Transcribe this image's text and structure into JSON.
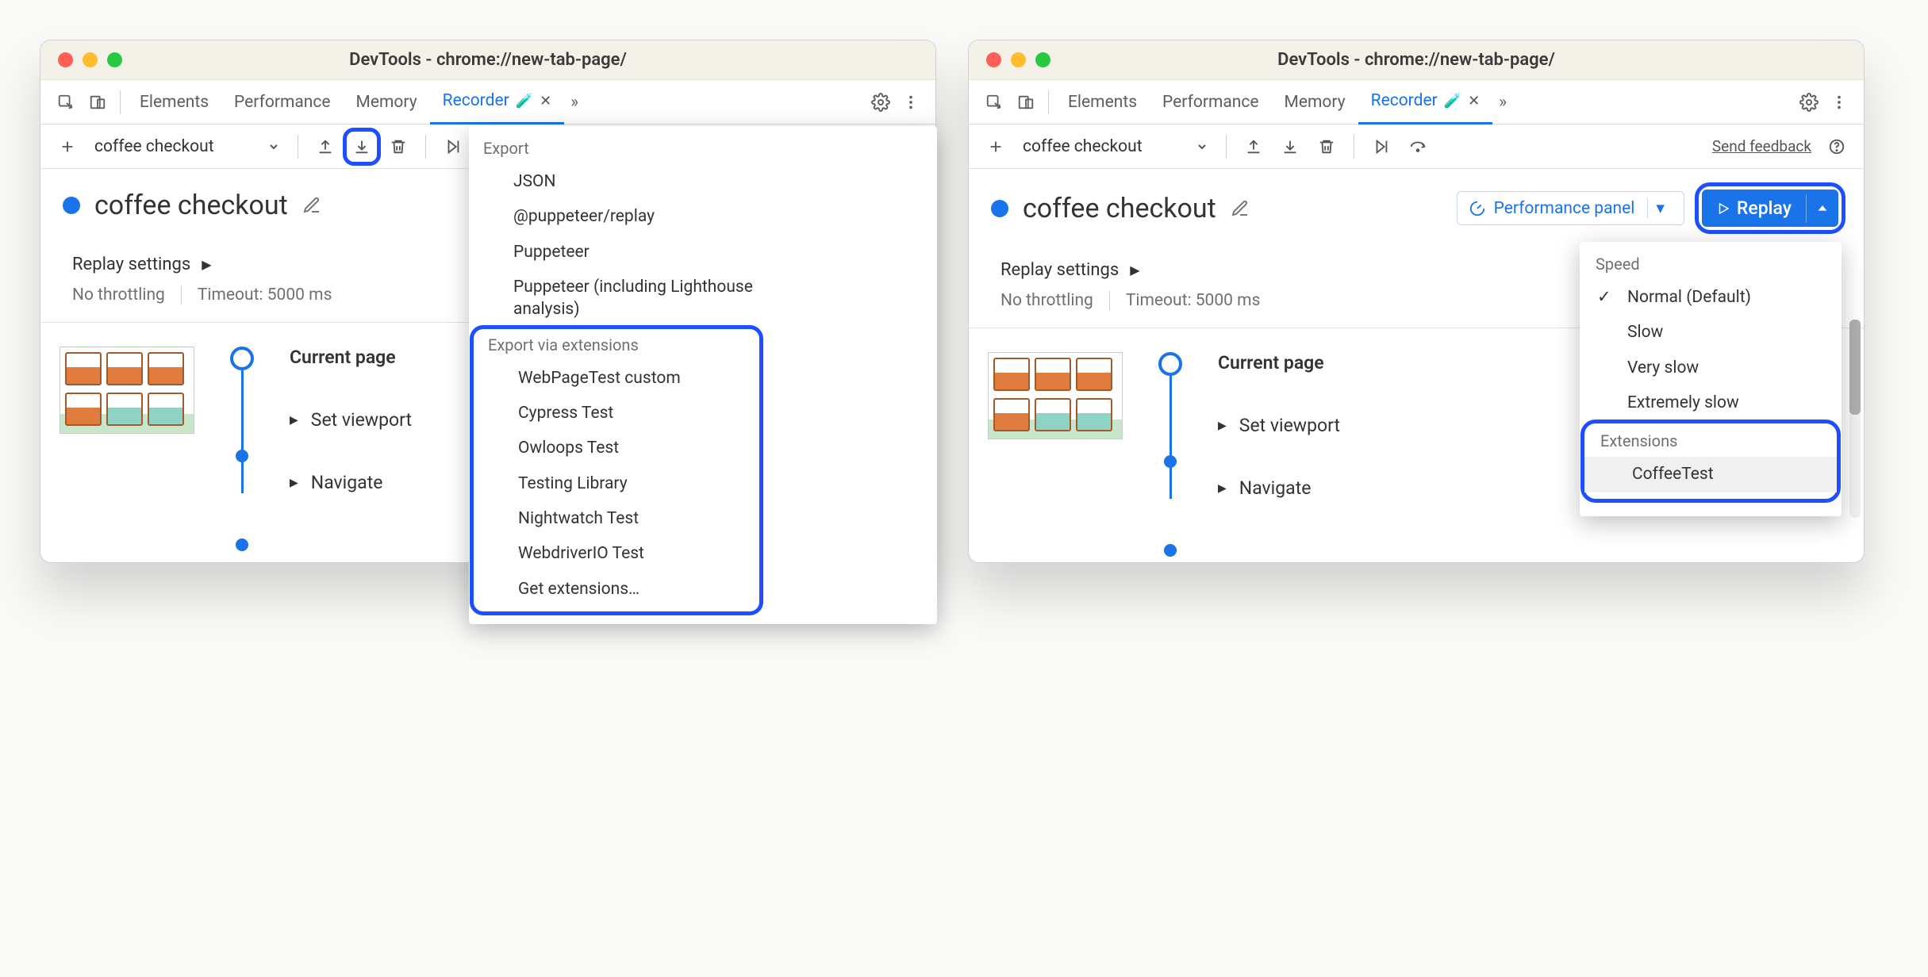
{
  "window_title": "DevTools - chrome://new-tab-page/",
  "tabs": {
    "elements": "Elements",
    "performance": "Performance",
    "memory": "Memory",
    "recorder": "Recorder",
    "recorder_experiment_icon": "🧪"
  },
  "more_tabs_icon": "»",
  "toolbar": {
    "recording_name": "coffee checkout",
    "send_feedback": "Send feedback"
  },
  "recording": {
    "title": "coffee checkout",
    "perf_panel_label": "Performance panel",
    "replay_label": "Replay"
  },
  "replay_settings": {
    "label": "Replay settings",
    "throttling": "No throttling",
    "timeout": "Timeout: 5000 ms"
  },
  "steps": {
    "current_page": "Current page",
    "set_viewport": "Set viewport",
    "navigate": "Navigate"
  },
  "export_menu": {
    "header_export": "Export",
    "items_builtin": [
      "JSON",
      "@puppeteer/replay",
      "Puppeteer",
      "Puppeteer (including Lighthouse analysis)"
    ],
    "header_ext": "Export via extensions",
    "items_ext": [
      "WebPageTest custom",
      "Cypress Test",
      "Owloops Test",
      "Testing Library",
      "Nightwatch Test",
      "WebdriverIO Test",
      "Get extensions…"
    ]
  },
  "replay_menu": {
    "header_speed": "Speed",
    "speeds": [
      {
        "label": "Normal (Default)",
        "checked": true
      },
      {
        "label": "Slow",
        "checked": false
      },
      {
        "label": "Very slow",
        "checked": false
      },
      {
        "label": "Extremely slow",
        "checked": false
      }
    ],
    "header_ext": "Extensions",
    "ext_items": [
      "CoffeeTest"
    ]
  }
}
